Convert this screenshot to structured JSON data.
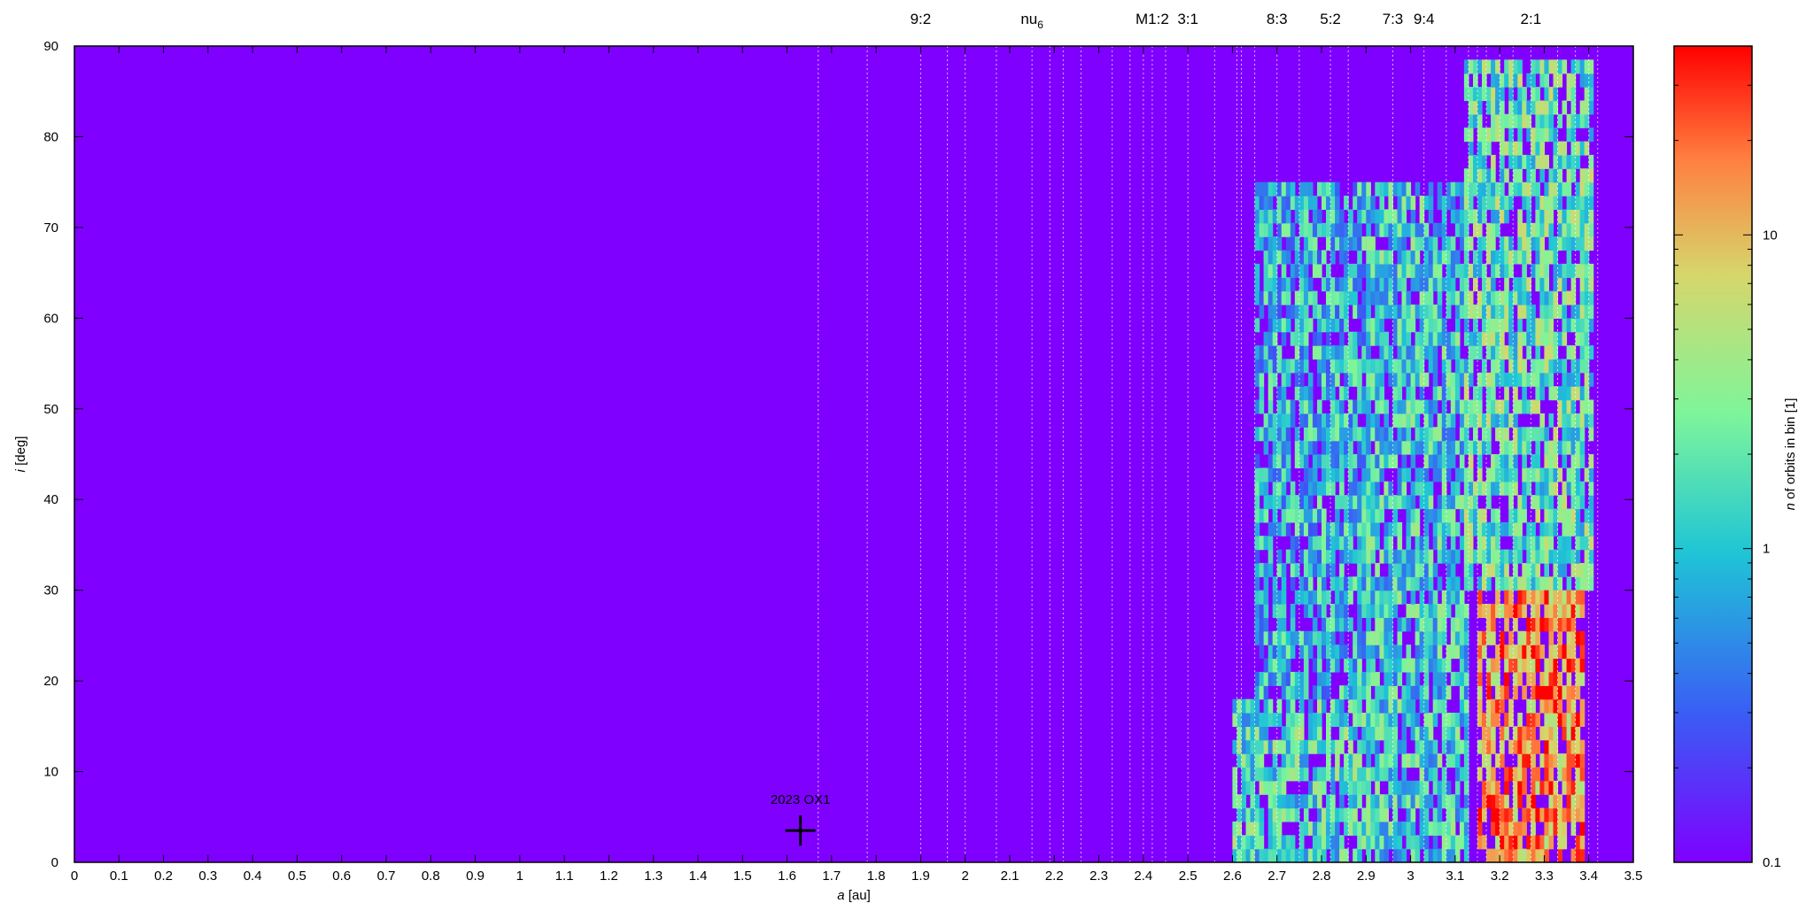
{
  "chart_data": {
    "type": "heatmap",
    "title": "",
    "xlabel": {
      "italic": "a",
      "unit": "[au]"
    },
    "ylabel": {
      "italic": "i",
      "unit": "[deg]"
    },
    "colorbar_label": {
      "italic": "n",
      "rest": " of orbits in bin [1]"
    },
    "colorscale": "rainbow",
    "color_scale_type": "log",
    "color_range": [
      0.1,
      40
    ],
    "colorbar_ticks": [
      "0.1",
      "1",
      "10"
    ],
    "colorbar_tick_values": [
      0.1,
      1,
      10
    ],
    "xlim": [
      0,
      3.5
    ],
    "ylim": [
      0,
      90
    ],
    "x_ticks": [
      "0",
      "0.1",
      "0.2",
      "0.3",
      "0.4",
      "0.5",
      "0.6",
      "0.7",
      "0.8",
      "0.9",
      "1",
      "1.1",
      "1.2",
      "1.3",
      "1.4",
      "1.5",
      "1.6",
      "1.7",
      "1.8",
      "1.9",
      "2",
      "2.1",
      "2.2",
      "2.3",
      "2.4",
      "2.5",
      "2.6",
      "2.7",
      "2.8",
      "2.9",
      "3",
      "3.1",
      "3.2",
      "3.3",
      "3.4",
      "3.5"
    ],
    "y_ticks": [
      "0",
      "10",
      "20",
      "30",
      "40",
      "50",
      "60",
      "70",
      "80",
      "90"
    ],
    "resonance_labels": [
      {
        "text": "9:2",
        "a": 1.9
      },
      {
        "text": "nu",
        "sub": "6",
        "a": 2.15
      },
      {
        "text": "M1:2",
        "a": 2.42
      },
      {
        "text": "3:1",
        "a": 2.5
      },
      {
        "text": "8:3",
        "a": 2.7
      },
      {
        "text": "5:2",
        "a": 2.82
      },
      {
        "text": "7:3",
        "a": 2.96
      },
      {
        "text": "9:4",
        "a": 3.03
      },
      {
        "text": "2:1",
        "a": 3.27
      }
    ],
    "resonance_lines": [
      1.67,
      1.78,
      1.9,
      1.96,
      2.0,
      2.07,
      2.15,
      2.19,
      2.22,
      2.26,
      2.33,
      2.37,
      2.4,
      2.42,
      2.45,
      2.5,
      2.56,
      2.61,
      2.62,
      2.65,
      2.7,
      2.75,
      2.82,
      2.86,
      2.96,
      3.03,
      3.08,
      3.13,
      3.15,
      3.17,
      3.2,
      3.23,
      3.27,
      3.33,
      3.37,
      3.4,
      3.42
    ],
    "marker": {
      "label": "2023 OX1",
      "a": 1.63,
      "i": 3.5,
      "symbol": "+"
    },
    "background_value": 0.1,
    "regions": [
      {
        "a_range": [
          2.6,
          2.9
        ],
        "i_range": [
          0,
          18
        ],
        "level": 1.5
      },
      {
        "a_range": [
          2.65,
          2.9
        ],
        "i_range": [
          18,
          75
        ],
        "level": 0.9
      },
      {
        "a_range": [
          2.9,
          3.12
        ],
        "i_range": [
          0,
          75
        ],
        "level": 1.2
      },
      {
        "a_range": [
          3.12,
          3.4
        ],
        "i_range": [
          30,
          88
        ],
        "level": 2.0
      },
      {
        "a_range": [
          3.15,
          3.38
        ],
        "i_range": [
          0,
          30
        ],
        "level": 15
      }
    ]
  }
}
